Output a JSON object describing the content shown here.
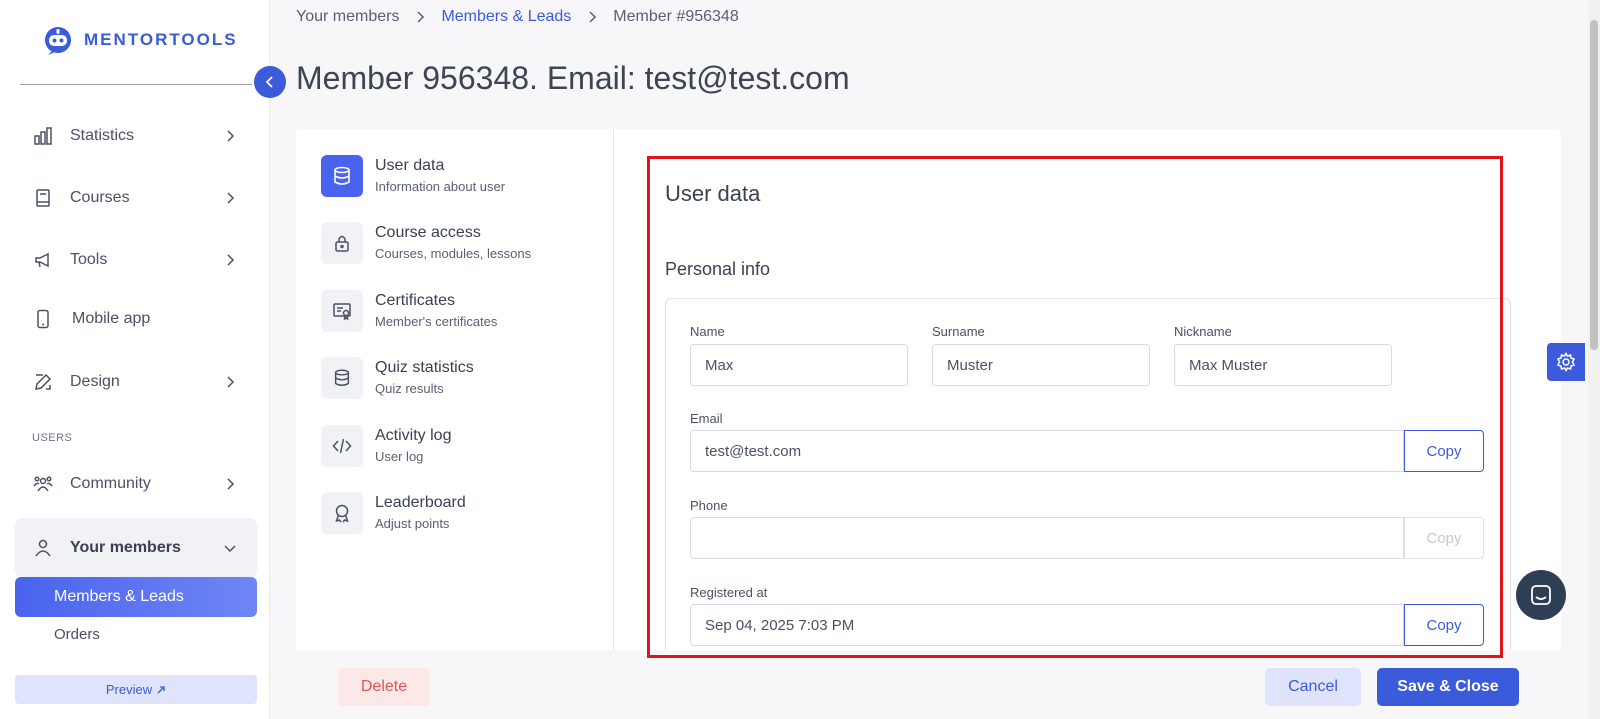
{
  "brand": {
    "name": "MENTORTOOLS",
    "color": "#3b5bdb"
  },
  "sidebar": {
    "items": [
      {
        "label": "Statistics",
        "icon": "bar-chart-icon",
        "has_chevron": true
      },
      {
        "label": "Courses",
        "icon": "book-icon",
        "has_chevron": true
      },
      {
        "label": "Tools",
        "icon": "megaphone-icon",
        "has_chevron": true
      },
      {
        "label": "Mobile app",
        "icon": "phone-icon",
        "has_chevron": false
      },
      {
        "label": "Design",
        "icon": "pencil-icon",
        "has_chevron": true
      }
    ],
    "users_section_label": "USERS",
    "community_label": "Community",
    "your_members_label": "Your members",
    "sub_items": {
      "members_leads": "Members & Leads",
      "orders": "Orders"
    },
    "preview_label": "Preview"
  },
  "breadcrumb": {
    "item1": "Your members",
    "item2": "Members & Leads",
    "item3": "Member #956348"
  },
  "page_title": "Member 956348. Email: test@test.com",
  "tabs": [
    {
      "title": "User data",
      "subtitle": "Information about user",
      "icon": "database-icon",
      "active": true
    },
    {
      "title": "Course access",
      "subtitle": "Courses, modules, lessons",
      "icon": "lock-icon",
      "active": false
    },
    {
      "title": "Certificates",
      "subtitle": "Member's certificates",
      "icon": "certificate-icon",
      "active": false
    },
    {
      "title": "Quiz statistics",
      "subtitle": "Quiz results",
      "icon": "database-icon",
      "active": false
    },
    {
      "title": "Activity log",
      "subtitle": "User log",
      "icon": "code-icon",
      "active": false
    },
    {
      "title": "Leaderboard",
      "subtitle": "Adjust points",
      "icon": "award-icon",
      "active": false
    }
  ],
  "panel": {
    "title": "User data",
    "section_title": "Personal info",
    "fields": {
      "name": {
        "label": "Name",
        "value": "Max"
      },
      "surname": {
        "label": "Surname",
        "value": "Muster"
      },
      "nickname": {
        "label": "Nickname",
        "value": "Max Muster"
      },
      "email": {
        "label": "Email",
        "value": "test@test.com",
        "copy_label": "Copy"
      },
      "phone": {
        "label": "Phone",
        "value": "",
        "copy_label": "Copy"
      },
      "registered": {
        "label": "Registered at",
        "value": "Sep 04, 2025 7:03 PM",
        "copy_label": "Copy"
      }
    }
  },
  "footer": {
    "delete_label": "Delete",
    "cancel_label": "Cancel",
    "save_label": "Save & Close"
  },
  "colors": {
    "accent": "#3b5bdb",
    "highlight": "#e0141b",
    "danger": "#e25555"
  }
}
